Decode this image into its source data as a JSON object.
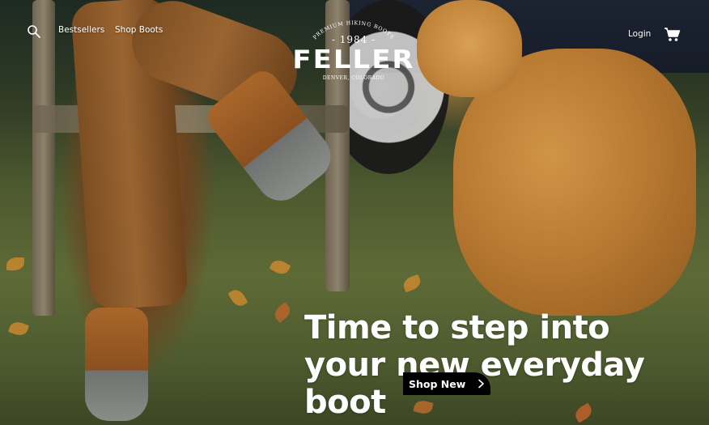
{
  "brand": {
    "arc_text": "PREMIUM HIKING BOOTS",
    "year": "- 1984 -",
    "name": "FELLER",
    "location": "DENVER, COLORADO"
  },
  "nav": {
    "search_icon": "search-icon",
    "links": [
      "Bestsellers",
      "Shop Boots"
    ],
    "login": "Login",
    "cart_icon": "cart-icon"
  },
  "hero": {
    "headline_lines": [
      "Time to step into",
      "your new everyday",
      "boot"
    ],
    "cta": {
      "label": "Shop New",
      "icon": "chevron-right-icon"
    }
  },
  "colors": {
    "text": "#ffffff",
    "cta_background": "#000000"
  }
}
